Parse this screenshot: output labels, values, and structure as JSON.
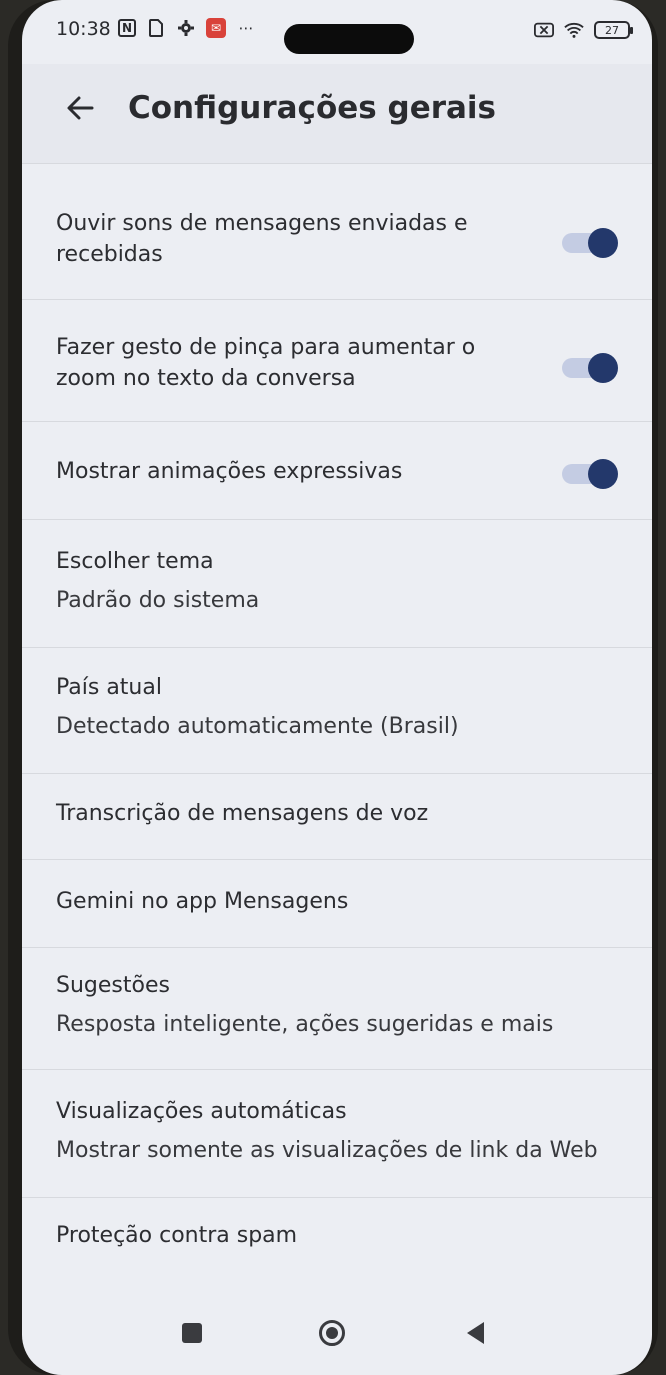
{
  "status": {
    "time": "10:38",
    "nfc_glyph": "N",
    "battery_level": "27",
    "icons": [
      "nfc-icon",
      "sim-icon",
      "gear-icon",
      "app-notification-icon",
      "more-icon",
      "x-signal-icon",
      "wifi-icon",
      "battery-icon"
    ]
  },
  "appbar": {
    "title": "Configurações gerais",
    "back_icon": "arrow-left-icon"
  },
  "settings": [
    {
      "id": "sounds",
      "title": "Ouvir sons de mensagens enviadas e recebidas",
      "title_line1": "Ouvir sons de mensagens enviadas e",
      "title_line2": "recebidas",
      "toggle": true,
      "checked": true
    },
    {
      "id": "pinch-zoom",
      "title": "Fazer gesto de pinça para aumentar o zoom no texto da conversa",
      "title_line1": "Fazer gesto de pinça para aumentar o",
      "title_line2": "zoom no texto da conversa",
      "toggle": true,
      "checked": true
    },
    {
      "id": "animations",
      "title": "Mostrar animações expressivas",
      "toggle": true,
      "checked": true
    },
    {
      "id": "theme",
      "title": "Escolher tema",
      "subtitle": "Padrão do sistema"
    },
    {
      "id": "country",
      "title": "País atual",
      "subtitle": "Detectado automaticamente (Brasil)"
    },
    {
      "id": "transcription",
      "title": "Transcrição de mensagens de voz"
    },
    {
      "id": "gemini",
      "title": "Gemini no app Mensagens"
    },
    {
      "id": "suggestions",
      "title": "Sugestões",
      "subtitle": "Resposta inteligente, ações sugeridas e mais"
    },
    {
      "id": "previews",
      "title": "Visualizações automáticas",
      "subtitle": "Mostrar somente as visualizações de link da Web"
    },
    {
      "id": "spam",
      "title": "Proteção contra spam"
    }
  ],
  "colors": {
    "background": "#eceef3",
    "toggle_thumb": "#23386b",
    "toggle_track": "#c4cce3",
    "text": "#2c2d31"
  },
  "navbar": {
    "icons": [
      "recents-icon",
      "home-icon",
      "back-triangle-icon"
    ]
  }
}
